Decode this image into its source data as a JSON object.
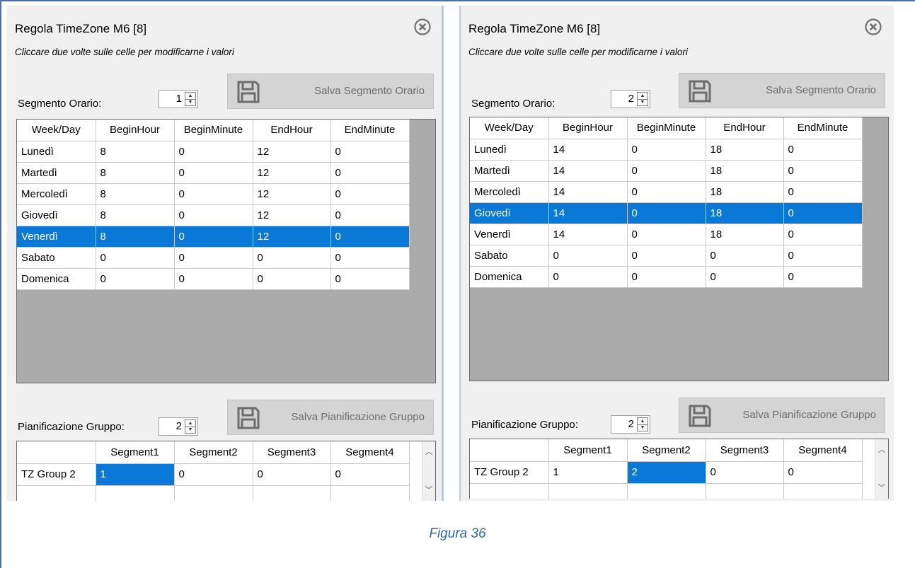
{
  "caption": "Figura 36",
  "panels": [
    {
      "title": "Regola TimeZone M6 [8]",
      "subtitle": "Cliccare due volte sulle celle per modificarne i valori",
      "segment_label": "Segmento Orario:",
      "segment_value": "1",
      "save_segment_label": "Salva Segmento Orario",
      "columns": [
        "Week/Day",
        "BeginHour",
        "BeginMinute",
        "EndHour",
        "EndMinute"
      ],
      "rows": [
        [
          "Lunedì",
          "8",
          "0",
          "12",
          "0"
        ],
        [
          "Martedì",
          "8",
          "0",
          "12",
          "0"
        ],
        [
          "Mercoledì",
          "8",
          "0",
          "12",
          "0"
        ],
        [
          "Giovedì",
          "8",
          "0",
          "12",
          "0"
        ],
        [
          "Venerdì",
          "8",
          "0",
          "12",
          "0"
        ],
        [
          "Sabato",
          "0",
          "0",
          "0",
          "0"
        ],
        [
          "Domenica",
          "0",
          "0",
          "0",
          "0"
        ]
      ],
      "selected_row": "Venerdì",
      "group_label": "Pianificazione Gruppo:",
      "group_value": "2",
      "save_group_label": "Salva Pianificazione Gruppo",
      "group_columns": [
        "",
        "Segment1",
        "Segment2",
        "Segment3",
        "Segment4"
      ],
      "group_row": [
        "TZ Group 2",
        "1",
        "0",
        "0",
        "0"
      ],
      "group_selected_column": "Segment1"
    },
    {
      "title": "Regola TimeZone M6 [8]",
      "subtitle": "Cliccare due volte sulle celle per modificarne i valori",
      "segment_label": "Segmento Orario:",
      "segment_value": "2",
      "save_segment_label": "Salva Segmento Orario",
      "columns": [
        "Week/Day",
        "BeginHour",
        "BeginMinute",
        "EndHour",
        "EndMinute"
      ],
      "rows": [
        [
          "Lunedì",
          "14",
          "0",
          "18",
          "0"
        ],
        [
          "Martedì",
          "14",
          "0",
          "18",
          "0"
        ],
        [
          "Mercoledì",
          "14",
          "0",
          "18",
          "0"
        ],
        [
          "Giovedì",
          "14",
          "0",
          "18",
          "0"
        ],
        [
          "Venerdì",
          "14",
          "0",
          "18",
          "0"
        ],
        [
          "Sabato",
          "0",
          "0",
          "0",
          "0"
        ],
        [
          "Domenica",
          "0",
          "0",
          "0",
          "0"
        ]
      ],
      "selected_row": "Giovedì",
      "group_label": "Pianificazione Gruppo:",
      "group_value": "2",
      "save_group_label": "Salva Pianificazione Gruppo",
      "group_columns": [
        "",
        "Segment1",
        "Segment2",
        "Segment3",
        "Segment4"
      ],
      "group_row": [
        "TZ Group 2",
        "1",
        "2",
        "0",
        "0"
      ],
      "group_selected_column": "Segment2"
    }
  ],
  "colors": {
    "selection": "#0a78d7",
    "caption": "#2f6aa6",
    "grid_background": "#ababab"
  },
  "icons": {
    "close": "close-circle-icon",
    "save": "floppy-disk-icon",
    "spin_up": "chevron-up-icon",
    "spin_down": "chevron-down-icon"
  }
}
